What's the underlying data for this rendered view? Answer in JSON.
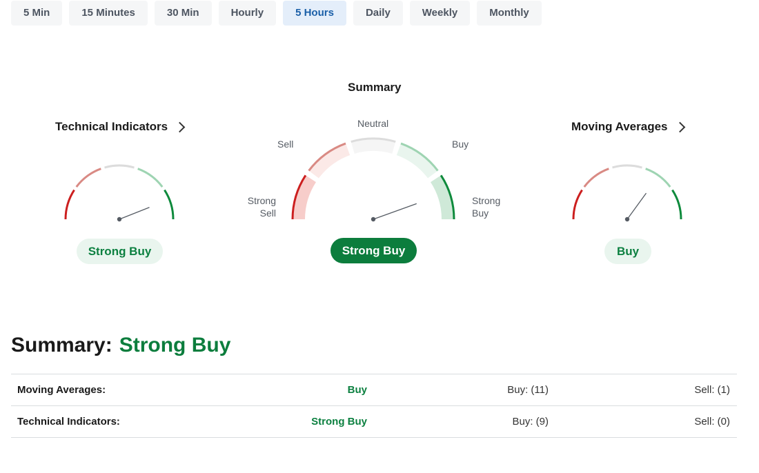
{
  "timeframes": [
    {
      "label": "5 Min",
      "active": false
    },
    {
      "label": "15 Minutes",
      "active": false
    },
    {
      "label": "30 Min",
      "active": false
    },
    {
      "label": "Hourly",
      "active": false
    },
    {
      "label": "5 Hours",
      "active": true
    },
    {
      "label": "Daily",
      "active": false
    },
    {
      "label": "Weekly",
      "active": false
    },
    {
      "label": "Monthly",
      "active": false
    }
  ],
  "technical": {
    "title": "Technical Indicators",
    "rating": "Strong Buy",
    "needle_level": 0.88
  },
  "summary_gauge": {
    "title": "Summary",
    "rating": "Strong Buy",
    "needle_level": 0.89,
    "labels": {
      "strong_sell": "Strong Sell",
      "sell": "Sell",
      "neutral": "Neutral",
      "buy": "Buy",
      "strong_buy": "Strong Buy"
    }
  },
  "moving_averages": {
    "title": "Moving Averages",
    "rating": "Buy",
    "needle_level": 0.7
  },
  "summary": {
    "label": "Summary:",
    "value": "Strong Buy"
  },
  "table": [
    {
      "name": "Moving Averages:",
      "rating": "Buy",
      "buy": "Buy: (11)",
      "sell": "Sell: (1)"
    },
    {
      "name": "Technical Indicators:",
      "rating": "Strong Buy",
      "buy": "Buy: (9)",
      "sell": "Sell: (0)"
    }
  ],
  "colors": {
    "strong_sell": "#cc1f1f",
    "sell": "#d98a84",
    "neutral": "#dcdcdc",
    "buy": "#9ed4b2",
    "strong_buy": "#0e8a3c",
    "needle": "#555b63",
    "accent_green": "#0c7d3d"
  }
}
